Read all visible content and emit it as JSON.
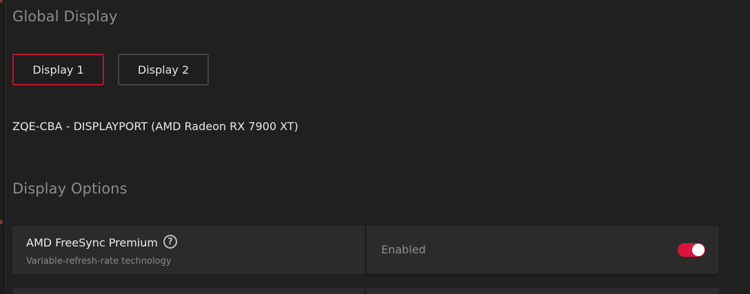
{
  "global_display": {
    "title": "Global Display",
    "tabs": [
      {
        "label": "Display 1",
        "selected": true
      },
      {
        "label": "Display 2",
        "selected": false
      }
    ],
    "device": "ZQE-CBA - DISPLAYPORT (AMD Radeon RX 7900 XT)"
  },
  "display_options": {
    "title": "Display Options",
    "options": [
      {
        "title": "AMD FreeSync Premium",
        "description": "Variable-refresh-rate technology",
        "value": "Enabled",
        "toggle_on": true,
        "help_icon": "question-circle-icon"
      }
    ]
  },
  "colors": {
    "accent": "#c8102e",
    "toggle_on": "#d6163c",
    "background": "#202020",
    "card": "#2b2b2b"
  }
}
